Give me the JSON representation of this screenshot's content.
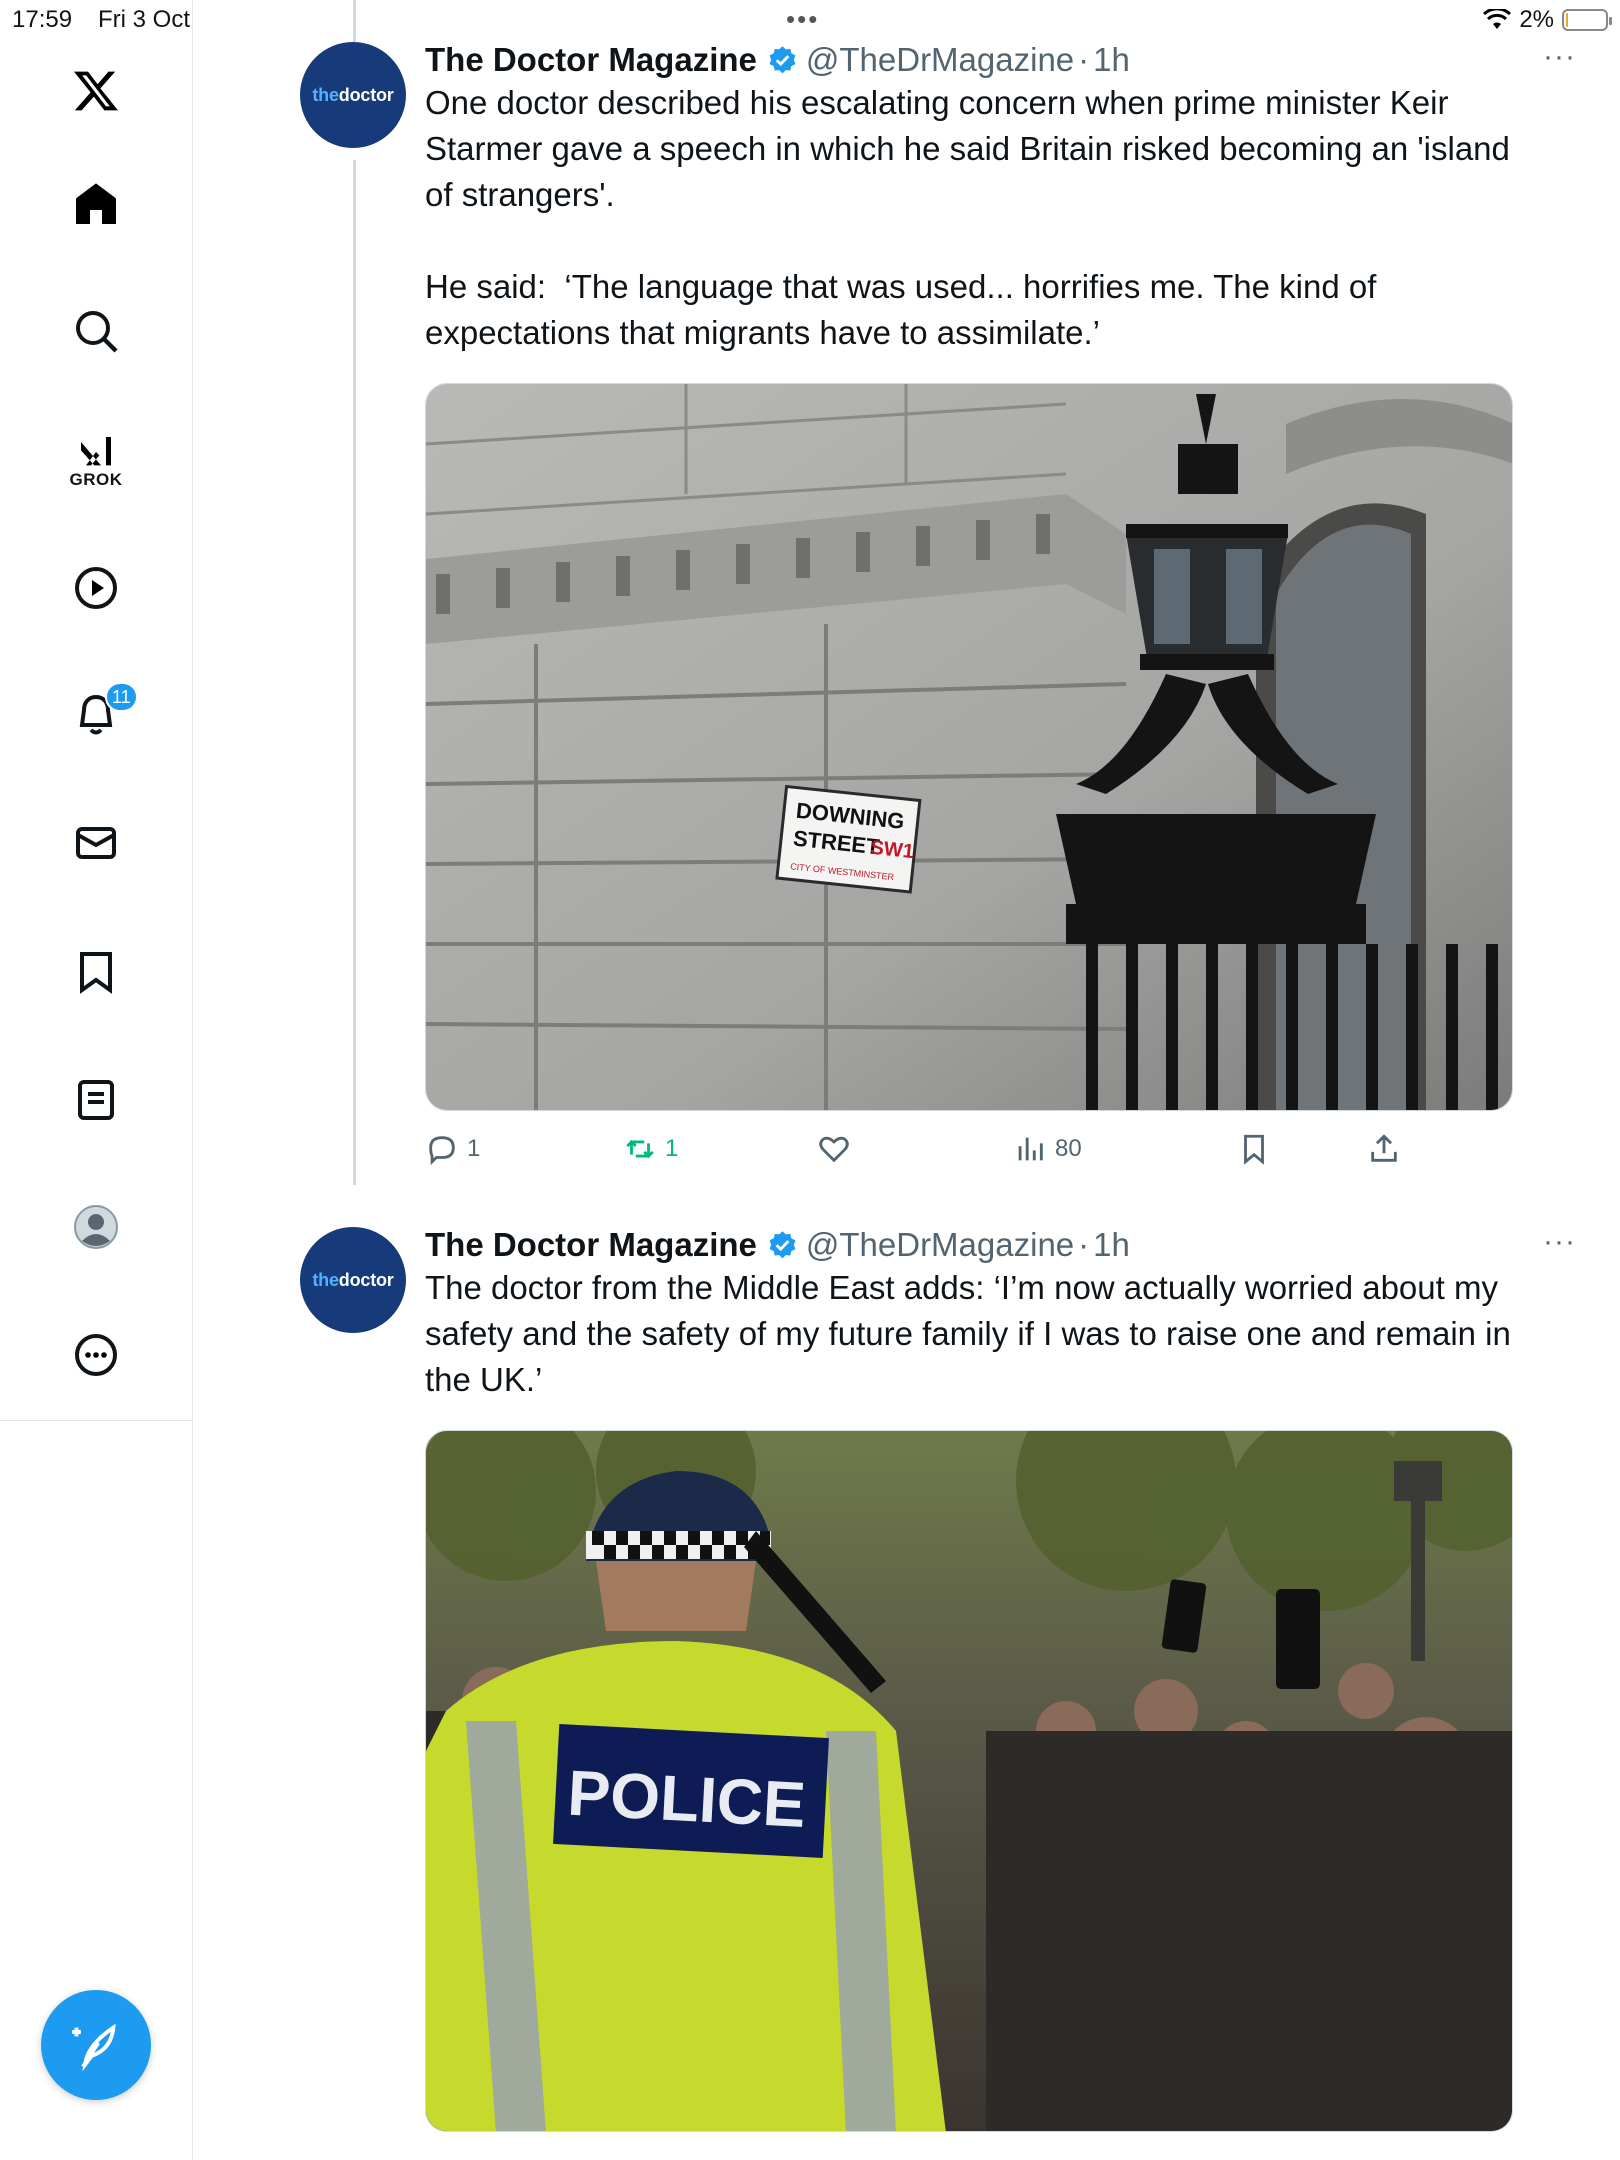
{
  "status_bar": {
    "time": "17:59",
    "date": "Fri 3 Oct",
    "battery": "2%",
    "battery_level": 0.02
  },
  "sidebar": {
    "logo": "x-logo-icon",
    "items": [
      {
        "name": "home",
        "icon": "home-icon"
      },
      {
        "name": "explore",
        "icon": "search-icon"
      },
      {
        "name": "grok",
        "icon": "grok-icon",
        "label": "GROK"
      },
      {
        "name": "videos",
        "icon": "play-icon"
      },
      {
        "name": "notifications",
        "icon": "bell-icon",
        "badge": "11"
      },
      {
        "name": "messages",
        "icon": "mail-icon"
      },
      {
        "name": "bookmarks",
        "icon": "bookmark-icon"
      },
      {
        "name": "lists",
        "icon": "list-icon"
      },
      {
        "name": "profile",
        "icon": "profile-icon"
      },
      {
        "name": "more",
        "icon": "more-icon"
      }
    ],
    "compose_icon": "compose-icon"
  },
  "tweets": [
    {
      "avatar_text_the": "the",
      "avatar_text_doctor": "doctor",
      "display_name": "The Doctor Magazine",
      "handle": "@TheDrMagazine",
      "separator": "·",
      "time": "1h",
      "more": "···",
      "text": "One doctor described his escalating concern when prime minister Keir Starmer gave a speech in which he said Britain risked becoming an 'island of strangers'.\n\nHe said:  ‘The language that was used... horrifies me. The kind of expectations that migrants have to assimilate.’",
      "media_sign_line1": "DOWNING",
      "media_sign_line2": "STREET",
      "media_sign_sw": "SW1",
      "media_sign_line3": "CITY OF WESTMINSTER",
      "replies": "1",
      "reposts": "1",
      "likes": "",
      "views": "80"
    },
    {
      "avatar_text_the": "the",
      "avatar_text_doctor": "doctor",
      "display_name": "The Doctor Magazine",
      "handle": "@TheDrMagazine",
      "separator": "·",
      "time": "1h",
      "more": "···",
      "text": "The doctor from the Middle East adds: ‘I’m now actually worried about my safety and the safety of my future family if I was to raise one and remain in the UK.’",
      "media_vest_text": "POLICE"
    }
  ],
  "colors": {
    "accent": "#1d9bf0",
    "retweet": "#00ba7c",
    "secondary_text": "#536471",
    "avatar_bg": "#163a7a"
  }
}
